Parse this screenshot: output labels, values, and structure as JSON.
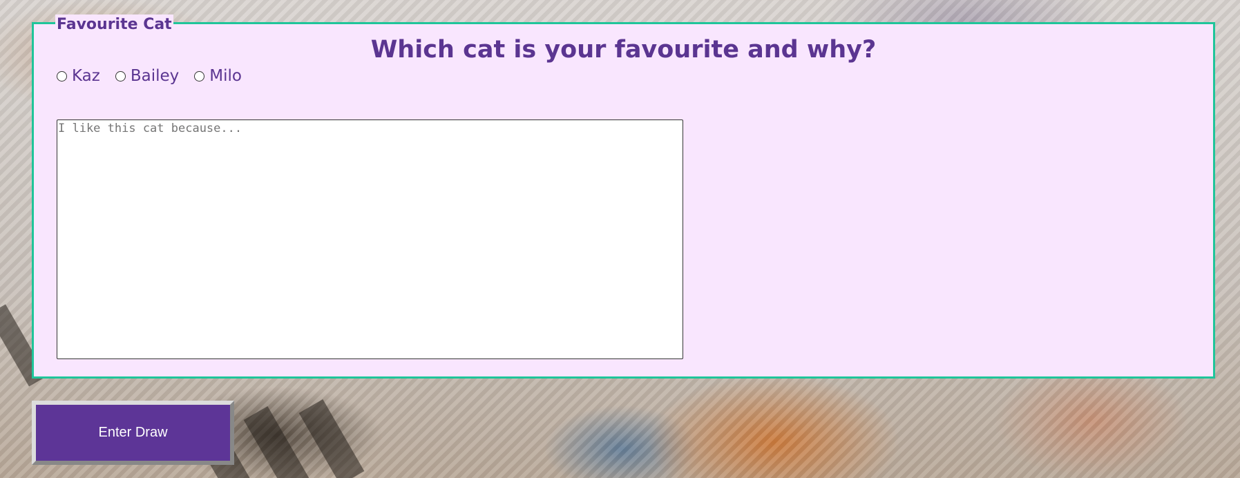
{
  "form": {
    "legend": "Favourite Cat",
    "question": "Which cat is your favourite and why?",
    "options": [
      {
        "label": "Kaz"
      },
      {
        "label": "Bailey"
      },
      {
        "label": "Milo"
      }
    ],
    "reason_placeholder": "I like this cat because...",
    "reason_value": "",
    "submit_label": "Enter Draw"
  },
  "colors": {
    "accent": "#5b3591",
    "fieldset_border": "#1fc59a",
    "fieldset_background": "#f9e6fe",
    "button_background": "#5d3597"
  }
}
